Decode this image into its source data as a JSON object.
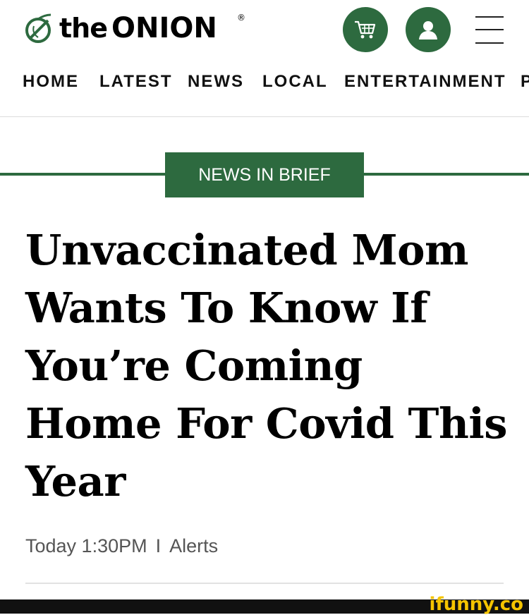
{
  "brand": {
    "logo_text_the": "the",
    "logo_text_onion": "ONION",
    "registered": "®",
    "accent_color": "#2d6a3f"
  },
  "header": {
    "cart_icon": "shopping-cart-icon",
    "account_icon": "user-icon",
    "menu_icon": "hamburger-menu-icon"
  },
  "nav": {
    "items": [
      {
        "label": "HOME"
      },
      {
        "label": "LATEST"
      },
      {
        "label": "NEWS"
      },
      {
        "label": "LOCAL"
      },
      {
        "label": "ENTERTAINMENT"
      },
      {
        "label": "P"
      }
    ]
  },
  "article": {
    "category": "NEWS IN BRIEF",
    "headline": "Unvaccinated Mom Wants To Know If You’re Coming Home For Covid This Year",
    "time": "Today 1:30PM",
    "separator": "I",
    "tag": "Alerts"
  },
  "watermark": {
    "text": "ifunny.co"
  }
}
